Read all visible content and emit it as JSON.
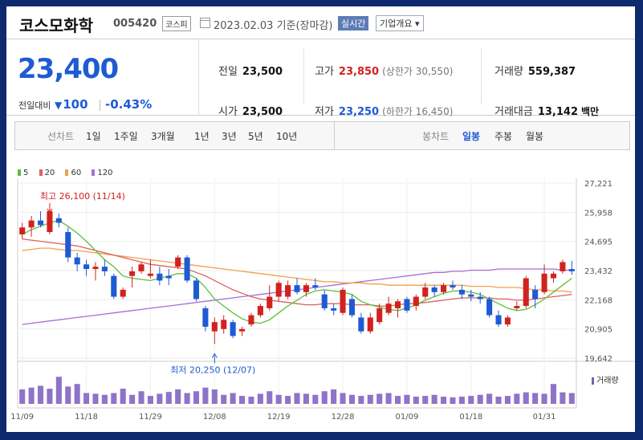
{
  "header": {
    "name": "코스모화학",
    "code": "005420",
    "market": "코스피",
    "date_text": "2023.02.03  기준(장마감)",
    "realtime_label": "실시간",
    "company_label": "기업개요 ▾"
  },
  "price": {
    "current": "23,400",
    "change_label": "전일대비",
    "change_abs": "100",
    "change_pct": "-0.43%"
  },
  "info": {
    "prev_label": "전일",
    "prev_val": "23,500",
    "high_label": "고가",
    "high_val": "23,850",
    "upper_limit": "(상한가 30,550)",
    "volume_label": "거래량",
    "volume_val": "559,387",
    "open_label": "시가",
    "open_val": "23,500",
    "low_label": "저가",
    "low_val": "23,250",
    "lower_limit": "(하한가 16,450)",
    "amount_label": "거래대금",
    "amount_val": "13,142",
    "amount_unit": "백만"
  },
  "toolbar": {
    "line_label": "선차트",
    "periods": [
      "1일",
      "1주일",
      "3개월",
      "1년",
      "3년",
      "5년",
      "10년"
    ],
    "candle_label": "봉차트",
    "candle_types": [
      "일봉",
      "주봉",
      "월봉"
    ],
    "active_candle": 0
  },
  "colors": {
    "up": "#d1221f",
    "down": "#1e5bd3",
    "ma5": "#5bbf3c",
    "ma20": "#e0605c",
    "ma60": "#f0a04b",
    "ma120": "#a66fd6",
    "volume": "#8e73c9"
  },
  "chart_data": {
    "type": "candlestick",
    "legend": [
      "5",
      "20",
      "60",
      "120"
    ],
    "y_ticks": [
      "27,221",
      "25,958",
      "24,695",
      "23,432",
      "22,168",
      "20,905",
      "19,642"
    ],
    "ylim": [
      19642,
      27221
    ],
    "x_ticks": [
      "11/09",
      "11/18",
      "11/29",
      "12/08",
      "12/19",
      "12/28",
      "01/09",
      "01/18",
      "01/31"
    ],
    "x_tick_index": [
      0,
      7,
      14,
      21,
      28,
      35,
      42,
      49,
      57
    ],
    "annotation_high": "최고 26,100 (11/14)",
    "annotation_low": "최저 20,250 (12/07)",
    "volume_label": "거래량",
    "candles": [
      {
        "o": 25000,
        "h": 25500,
        "l": 24800,
        "c": 25300
      },
      {
        "o": 25300,
        "h": 25800,
        "l": 24900,
        "c": 25600
      },
      {
        "o": 25600,
        "h": 26000,
        "l": 25300,
        "c": 25400
      },
      {
        "o": 25100,
        "h": 26100,
        "l": 25000,
        "c": 26000
      },
      {
        "o": 25700,
        "h": 25900,
        "l": 25300,
        "c": 25500
      },
      {
        "o": 25100,
        "h": 25300,
        "l": 23800,
        "c": 24000
      },
      {
        "o": 24000,
        "h": 24200,
        "l": 23400,
        "c": 23700
      },
      {
        "o": 23700,
        "h": 23900,
        "l": 23200,
        "c": 23500
      },
      {
        "o": 23500,
        "h": 23800,
        "l": 23000,
        "c": 23600
      },
      {
        "o": 23600,
        "h": 23900,
        "l": 23200,
        "c": 23400
      },
      {
        "o": 23200,
        "h": 23300,
        "l": 22200,
        "c": 22300
      },
      {
        "o": 22300,
        "h": 22700,
        "l": 22200,
        "c": 22600
      },
      {
        "o": 23200,
        "h": 23600,
        "l": 22700,
        "c": 23400
      },
      {
        "o": 23400,
        "h": 23800,
        "l": 23300,
        "c": 23700
      },
      {
        "o": 23200,
        "h": 23900,
        "l": 23100,
        "c": 23300
      },
      {
        "o": 23300,
        "h": 23600,
        "l": 22800,
        "c": 23000
      },
      {
        "o": 23200,
        "h": 23500,
        "l": 22800,
        "c": 23100
      },
      {
        "o": 23600,
        "h": 24100,
        "l": 23500,
        "c": 24000
      },
      {
        "o": 24000,
        "h": 24100,
        "l": 22900,
        "c": 23000
      },
      {
        "o": 23000,
        "h": 23100,
        "l": 22100,
        "c": 22200
      },
      {
        "o": 21800,
        "h": 21900,
        "l": 20800,
        "c": 21000
      },
      {
        "o": 20800,
        "h": 21400,
        "l": 20250,
        "c": 21200
      },
      {
        "o": 20900,
        "h": 21500,
        "l": 20700,
        "c": 21300
      },
      {
        "o": 21200,
        "h": 21300,
        "l": 20500,
        "c": 20600
      },
      {
        "o": 20800,
        "h": 21000,
        "l": 20600,
        "c": 20900
      },
      {
        "o": 21100,
        "h": 21600,
        "l": 21000,
        "c": 21500
      },
      {
        "o": 21500,
        "h": 22000,
        "l": 21400,
        "c": 21900
      },
      {
        "o": 21800,
        "h": 22800,
        "l": 21700,
        "c": 22300
      },
      {
        "o": 22300,
        "h": 23000,
        "l": 22100,
        "c": 22900
      },
      {
        "o": 22300,
        "h": 23000,
        "l": 22200,
        "c": 22800
      },
      {
        "o": 22800,
        "h": 23100,
        "l": 22400,
        "c": 22500
      },
      {
        "o": 22500,
        "h": 22900,
        "l": 22300,
        "c": 22800
      },
      {
        "o": 22800,
        "h": 23100,
        "l": 22600,
        "c": 22700
      },
      {
        "o": 22400,
        "h": 22600,
        "l": 21700,
        "c": 21800
      },
      {
        "o": 21800,
        "h": 22000,
        "l": 21500,
        "c": 21700
      },
      {
        "o": 21600,
        "h": 22700,
        "l": 21500,
        "c": 22600
      },
      {
        "o": 22200,
        "h": 22400,
        "l": 21400,
        "c": 21500
      },
      {
        "o": 21400,
        "h": 21600,
        "l": 20700,
        "c": 20800
      },
      {
        "o": 20800,
        "h": 21600,
        "l": 20700,
        "c": 21400
      },
      {
        "o": 21200,
        "h": 22000,
        "l": 21100,
        "c": 21800
      },
      {
        "o": 21600,
        "h": 22300,
        "l": 21500,
        "c": 22000
      },
      {
        "o": 21800,
        "h": 22200,
        "l": 21400,
        "c": 22100
      },
      {
        "o": 22200,
        "h": 22300,
        "l": 21600,
        "c": 21700
      },
      {
        "o": 21900,
        "h": 22400,
        "l": 21700,
        "c": 22300
      },
      {
        "o": 22300,
        "h": 22900,
        "l": 22200,
        "c": 22700
      },
      {
        "o": 22700,
        "h": 22800,
        "l": 22300,
        "c": 22500
      },
      {
        "o": 22500,
        "h": 22900,
        "l": 22400,
        "c": 22800
      },
      {
        "o": 22800,
        "h": 23000,
        "l": 22600,
        "c": 22700
      },
      {
        "o": 22600,
        "h": 22800,
        "l": 22200,
        "c": 22400
      },
      {
        "o": 22400,
        "h": 22600,
        "l": 22100,
        "c": 22300
      },
      {
        "o": 22300,
        "h": 22500,
        "l": 22000,
        "c": 22200
      },
      {
        "o": 22200,
        "h": 22300,
        "l": 21400,
        "c": 21500
      },
      {
        "o": 21500,
        "h": 21700,
        "l": 21000,
        "c": 21100
      },
      {
        "o": 21100,
        "h": 21500,
        "l": 21000,
        "c": 21400
      },
      {
        "o": 21800,
        "h": 22100,
        "l": 21700,
        "c": 21900
      },
      {
        "o": 21900,
        "h": 23200,
        "l": 21800,
        "c": 23100
      },
      {
        "o": 22600,
        "h": 22800,
        "l": 21800,
        "c": 22200
      },
      {
        "o": 22500,
        "h": 23700,
        "l": 22400,
        "c": 23300
      },
      {
        "o": 23100,
        "h": 23400,
        "l": 22900,
        "c": 23300
      },
      {
        "o": 23400,
        "h": 23900,
        "l": 23300,
        "c": 23800
      },
      {
        "o": 23500,
        "h": 23850,
        "l": 23250,
        "c": 23400
      }
    ],
    "ma5": [
      25000,
      25200,
      25350,
      25500,
      25600,
      25350,
      25050,
      24700,
      24300,
      23900,
      23600,
      23200,
      23100,
      23050,
      23000,
      23100,
      23200,
      23300,
      23300,
      23100,
      22700,
      22200,
      21900,
      21600,
      21350,
      21200,
      21150,
      21300,
      21600,
      21900,
      22150,
      22400,
      22550,
      22600,
      22550,
      22500,
      22400,
      22100,
      21950,
      21850,
      21750,
      21700,
      21800,
      21950,
      22150,
      22300,
      22450,
      22550,
      22550,
      22500,
      22400,
      22200,
      22000,
      21800,
      21700,
      21750,
      21950,
      22200,
      22500,
      22800,
      23100
    ],
    "ma20": [
      24800,
      24750,
      24700,
      24650,
      24600,
      24550,
      24500,
      24400,
      24300,
      24200,
      24100,
      24000,
      23900,
      23800,
      23700,
      23650,
      23600,
      23550,
      23500,
      23350,
      23200,
      23000,
      22800,
      22600,
      22450,
      22300,
      22200,
      22150,
      22100,
      22050,
      22000,
      21950,
      21950,
      22000,
      22000,
      22000,
      21950,
      21950,
      21950,
      21900,
      21900,
      21950,
      22000,
      22000,
      22050,
      22100,
      22150,
      22200,
      22250,
      22250,
      22250,
      22250,
      22200,
      22200,
      22150,
      22150,
      22200,
      22250,
      22300,
      22350,
      22400
    ],
    "ma60": [
      24300,
      24350,
      24400,
      24400,
      24350,
      24300,
      24300,
      24250,
      24200,
      24150,
      24100,
      24050,
      24000,
      23950,
      23900,
      23850,
      23800,
      23750,
      23700,
      23650,
      23600,
      23550,
      23500,
      23450,
      23400,
      23350,
      23300,
      23250,
      23200,
      23150,
      23100,
      23050,
      23000,
      22950,
      22950,
      22900,
      22900,
      22900,
      22850,
      22850,
      22800,
      22800,
      22800,
      22800,
      22800,
      22800,
      22800,
      22800,
      22800,
      22750,
      22750,
      22750,
      22700,
      22700,
      22700,
      22650,
      22600,
      22600,
      22550,
      22550,
      22500
    ],
    "ma120": [
      21100,
      21150,
      21200,
      21250,
      21300,
      21350,
      21400,
      21450,
      21500,
      21550,
      21600,
      21650,
      21700,
      21750,
      21800,
      21850,
      21900,
      21950,
      22000,
      22050,
      22100,
      22150,
      22200,
      22250,
      22300,
      22350,
      22400,
      22450,
      22500,
      22550,
      22600,
      22650,
      22700,
      22750,
      22800,
      22850,
      22900,
      22950,
      23000,
      23050,
      23100,
      23150,
      23200,
      23250,
      23300,
      23350,
      23350,
      23400,
      23400,
      23450,
      23450,
      23450,
      23500,
      23500,
      23500,
      23500,
      23500,
      23500,
      23500,
      23450,
      23450
    ],
    "volume": [
      0.4,
      0.45,
      0.5,
      0.42,
      0.75,
      0.48,
      0.55,
      0.3,
      0.28,
      0.25,
      0.3,
      0.42,
      0.25,
      0.35,
      0.22,
      0.28,
      0.33,
      0.4,
      0.3,
      0.35,
      0.45,
      0.4,
      0.25,
      0.3,
      0.22,
      0.2,
      0.28,
      0.35,
      0.25,
      0.22,
      0.3,
      0.28,
      0.25,
      0.35,
      0.4,
      0.3,
      0.25,
      0.22,
      0.25,
      0.28,
      0.3,
      0.22,
      0.25,
      0.2,
      0.22,
      0.25,
      0.2,
      0.18,
      0.2,
      0.22,
      0.25,
      0.28,
      0.2,
      0.22,
      0.28,
      0.32,
      0.3,
      0.28,
      0.55,
      0.32,
      0.3
    ]
  }
}
